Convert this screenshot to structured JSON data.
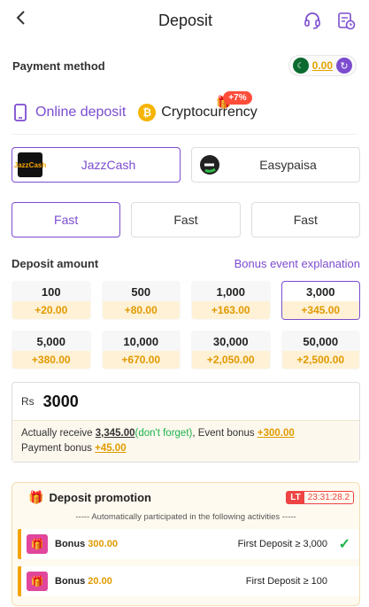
{
  "header": {
    "back_icon": "chevron-left-icon",
    "title": "Deposit",
    "support_icon": "headset-icon",
    "history_icon": "history-icon"
  },
  "payment_method": {
    "label": "Payment method",
    "balance": "0.00"
  },
  "tabs": [
    {
      "label": "Online deposit",
      "icon": "phone-icon",
      "active": true
    },
    {
      "label": "Cryptocurrency",
      "icon": "bitcoin-icon",
      "active": false,
      "badge": "+7%"
    }
  ],
  "methods": [
    {
      "label": "JazzCash",
      "logo_text": "JazzCash",
      "active": true
    },
    {
      "label": "Easypaisa",
      "logo_text": "",
      "active": false
    }
  ],
  "speeds": [
    {
      "label": "Fast",
      "active": true
    },
    {
      "label": "Fast",
      "active": false
    },
    {
      "label": "Fast",
      "active": false
    }
  ],
  "deposit": {
    "label": "Deposit amount",
    "bonus_link": "Bonus event explanation",
    "amounts": [
      {
        "value": "100",
        "bonus": "+20.00"
      },
      {
        "value": "500",
        "bonus": "+80.00"
      },
      {
        "value": "1,000",
        "bonus": "+163.00"
      },
      {
        "value": "3,000",
        "bonus": "+345.00"
      },
      {
        "value": "5,000",
        "bonus": "+380.00"
      },
      {
        "value": "10,000",
        "bonus": "+670.00"
      },
      {
        "value": "30,000",
        "bonus": "+2,050.00"
      },
      {
        "value": "50,000",
        "bonus": "+2,500.00"
      }
    ],
    "selected_index": 3
  },
  "input": {
    "currency": "Rs",
    "value": "3000",
    "receive_prefix": "Actually receive ",
    "receive_amount": "3,345.00",
    "receive_note": "(don't forget)",
    "event_prefix": ", Event bonus ",
    "event_bonus": "+300.00",
    "payment_prefix": "Payment bonus ",
    "payment_bonus": "+45.00"
  },
  "promotion": {
    "title": "Deposit promotion",
    "timer_tag": "LT",
    "timer": "23:31:28.2",
    "note": "----- Automatically participated in the following activities -----",
    "bonus_label": "Bonus",
    "rows": [
      {
        "bonus": "300.00",
        "condition": "First Deposit ≥ 3,000",
        "checked": true
      },
      {
        "bonus": "20.00",
        "condition": "First Deposit ≥ 100",
        "checked": false
      }
    ]
  },
  "colors": {
    "accent": "#7b4ccf",
    "bonus": "#e09a00",
    "success": "#1bb34a",
    "alert": "#ee4444"
  }
}
